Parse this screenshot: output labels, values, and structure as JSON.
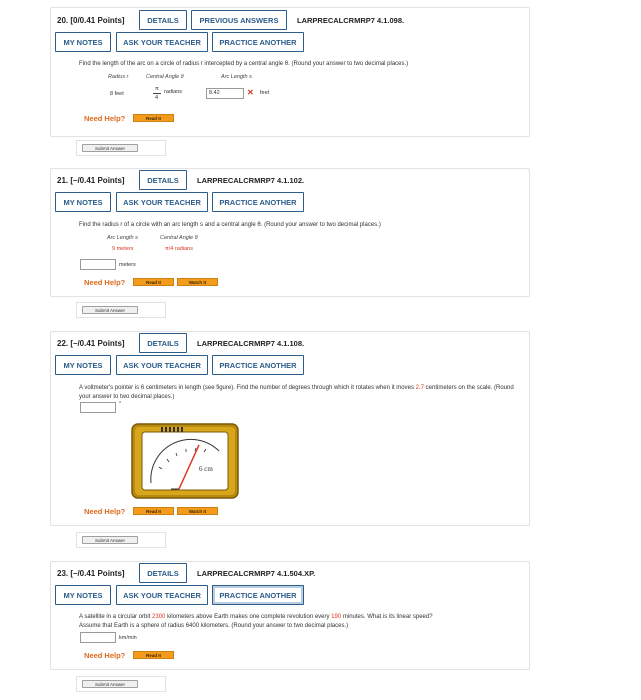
{
  "buttons": {
    "details": "DETAILS",
    "previous_answers": "PREVIOUS ANSWERS",
    "my_notes": "MY NOTES",
    "ask_teacher": "ASK YOUR TEACHER",
    "practice_another": "PRACTICE ANOTHER",
    "need_help": "Need Help?",
    "read_it": "Read It",
    "watch_it": "Watch It",
    "submit_answer": "Submit Answer"
  },
  "q20": {
    "header": "20. [0/0.41 Points]",
    "code": "LARPRECALCRMRP7 4.1.098.",
    "prompt": "Find the length of the arc on a circle of radius r intercepted by a central angle θ. (Round your answer to two decimal places.)",
    "col_radius": "Radius r",
    "col_angle": "Central Angle θ",
    "col_arc": "Arc Length s",
    "radius_value": "8 feet",
    "angle_num": "π",
    "angle_den": "4",
    "angle_unit": "radians",
    "answer_value": "8.42",
    "answer_unit": "feet",
    "wrong_mark": "✕"
  },
  "q21": {
    "header": "21. [–/0.41 Points]",
    "code": "LARPRECALCRMRP7 4.1.102.",
    "prompt": "Find the radius r of a circle with an arc length s and a central angle θ. (Round your answer to two decimal places.)",
    "col_arc": "Arc Length s",
    "col_angle": "Central Angle θ",
    "arc_value": "9 meters",
    "angle_value": "π/4 radians",
    "answer_unit": "meters"
  },
  "q22": {
    "header": "22. [–/0.41 Points]",
    "code": "LARPRECALCRMRP7 4.1.108.",
    "prompt_a": "A voltmeter's pointer is 6 centimeters in length (see figure). Find the number of degrees through which it rotates when it moves",
    "prompt_highlight": "2.7",
    "prompt_b": "centimeters on the scale. (Round your answer to two decimal places.)",
    "degree_symbol": "°",
    "figure_label": "6 cm"
  },
  "q23": {
    "header": "23. [–/0.41 Points]",
    "code": "LARPRECALCRMRP7 4.1.504.XP.",
    "prompt_a": "A satellite in a circular orbit",
    "prompt_km": "2300",
    "prompt_b": "kilometers above Earth makes one complete revolution every",
    "prompt_min": "190",
    "prompt_c": "minutes. What is its linear speed?",
    "prompt_d": "Assume that Earth is a sphere of radius 6400 kilometers. (Round your answer to two decimal places.)",
    "answer_unit": "km/min"
  },
  "colors": {
    "accent": "#2b5c8a",
    "need_help": "#e06a1e",
    "mini_button": "#f39c1c",
    "error": "#d9361f"
  }
}
